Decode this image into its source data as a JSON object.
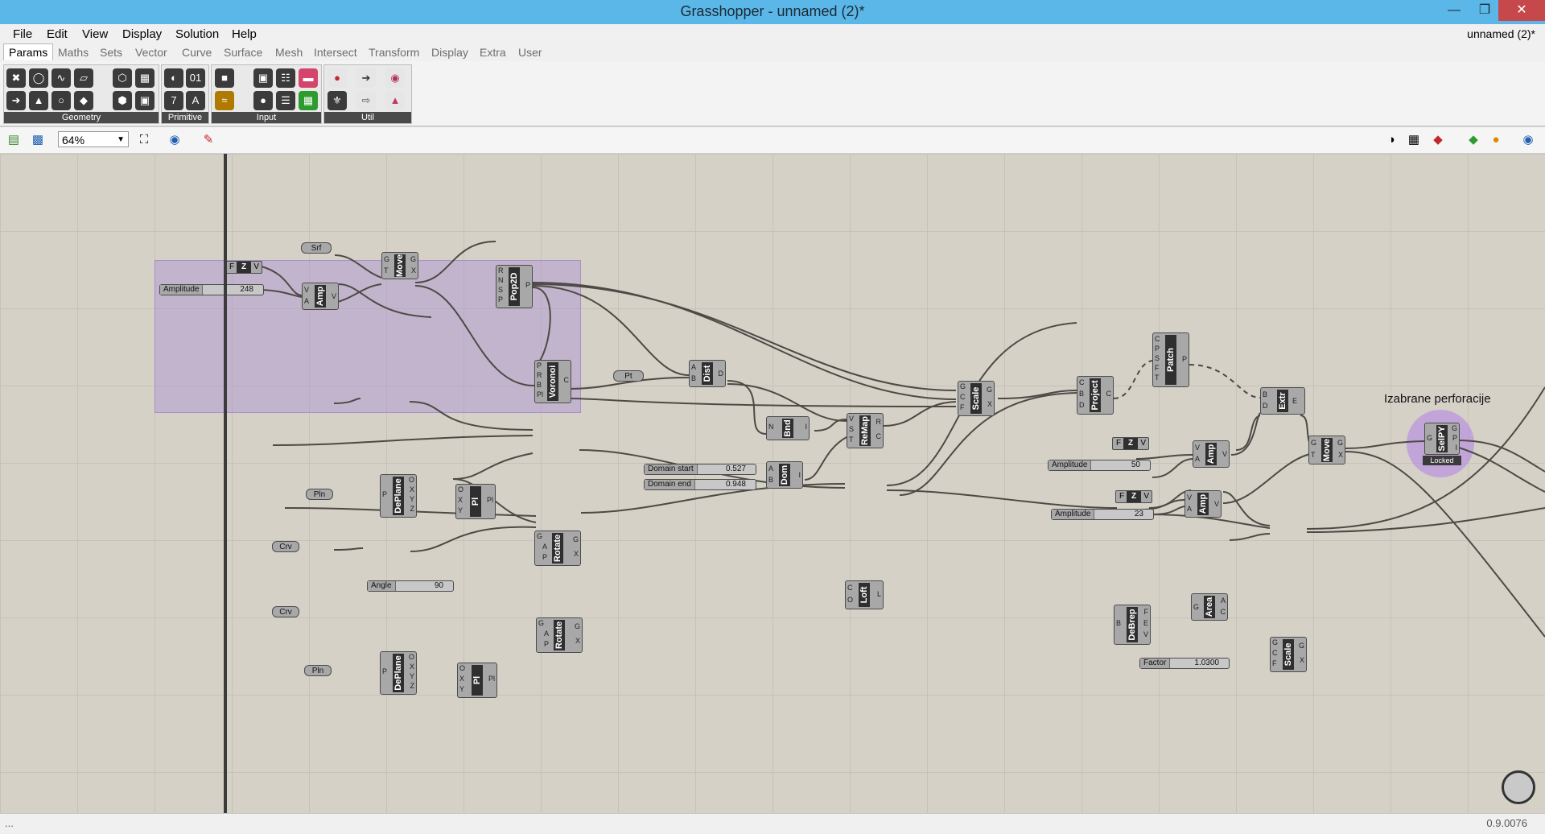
{
  "window": {
    "title": "Grasshopper - unnamed (2)*",
    "doc_name": "unnamed (2)*"
  },
  "menu": [
    "File",
    "Edit",
    "View",
    "Display",
    "Solution",
    "Help"
  ],
  "tabs": [
    "Params",
    "Maths",
    "Sets",
    "Vector",
    "Curve",
    "Surface",
    "Mesh",
    "Intersect",
    "Transform",
    "Display",
    "Extra",
    "User"
  ],
  "ribbon_groups": [
    "Geometry",
    "Primitive",
    "Input",
    "Util"
  ],
  "toolbar": {
    "zoom": "64%"
  },
  "canvas": {
    "annotation": "Izabrane perforacije",
    "components": [
      {
        "label": "Pop2D",
        "inputs": [
          "R",
          "N",
          "S",
          "P"
        ],
        "outputs": [
          "P"
        ]
      },
      {
        "label": "Move",
        "inputs": [
          "G",
          "T"
        ],
        "outputs": [
          "G",
          "X"
        ]
      },
      {
        "label": "Amp",
        "inputs": [
          "V",
          "A"
        ],
        "outputs": [
          "V"
        ]
      },
      {
        "label": "Voronoi",
        "inputs": [
          "P",
          "R",
          "B",
          "Pl"
        ],
        "outputs": [
          "C"
        ]
      },
      {
        "label": "Dist",
        "inputs": [
          "A",
          "B"
        ],
        "outputs": [
          "D"
        ]
      },
      {
        "label": "Bnd",
        "inputs": [
          "N"
        ],
        "outputs": [
          "I"
        ]
      },
      {
        "label": "ReMap",
        "inputs": [
          "V",
          "S",
          "T"
        ],
        "outputs": [
          "R",
          "C"
        ]
      },
      {
        "label": "Dom",
        "inputs": [
          "A",
          "B"
        ],
        "outputs": [
          "I"
        ]
      },
      {
        "label": "Scale",
        "inputs": [
          "G",
          "C",
          "F"
        ],
        "outputs": [
          "G",
          "X"
        ]
      },
      {
        "label": "Project",
        "inputs": [
          "C",
          "B",
          "D"
        ],
        "outputs": [
          "C"
        ]
      },
      {
        "label": "Patch",
        "inputs": [
          "C",
          "P",
          "S",
          "F",
          "T"
        ],
        "outputs": [
          "P"
        ]
      },
      {
        "label": "Extr",
        "inputs": [
          "B",
          "D"
        ],
        "outputs": [
          "E"
        ]
      },
      {
        "label": "Amp",
        "inputs": [
          "V",
          "A"
        ],
        "outputs": [
          "V"
        ]
      },
      {
        "label": "Amp",
        "inputs": [
          "V",
          "A"
        ],
        "outputs": [
          "V"
        ]
      },
      {
        "label": "Move",
        "inputs": [
          "G",
          "T"
        ],
        "outputs": [
          "G",
          "X"
        ]
      },
      {
        "label": "SelPY",
        "inputs": [
          "G"
        ],
        "outputs": [
          "G",
          "P",
          "I"
        ]
      },
      {
        "label": "DePlane",
        "inputs": [
          "P"
        ],
        "outputs": [
          "O",
          "X",
          "Y",
          "Z"
        ]
      },
      {
        "label": "Pl",
        "inputs": [
          "O",
          "X",
          "Y"
        ],
        "outputs": [
          "Pl"
        ]
      },
      {
        "label": "Rotate",
        "inputs": [
          "G",
          "A",
          "P"
        ],
        "outputs": [
          "G",
          "X"
        ]
      },
      {
        "label": "Rotate",
        "inputs": [
          "G",
          "A",
          "P"
        ],
        "outputs": [
          "G",
          "X"
        ]
      },
      {
        "label": "DePlane",
        "inputs": [
          "P"
        ],
        "outputs": [
          "O",
          "X",
          "Y",
          "Z"
        ]
      },
      {
        "label": "Pl",
        "inputs": [
          "O",
          "X",
          "Y"
        ],
        "outputs": [
          "Pl"
        ]
      },
      {
        "label": "Loft",
        "inputs": [
          "C",
          "O"
        ],
        "outputs": [
          "L"
        ]
      },
      {
        "label": "DeBrep",
        "inputs": [
          "B"
        ],
        "outputs": [
          "F",
          "E",
          "V"
        ]
      },
      {
        "label": "Area",
        "inputs": [
          "G"
        ],
        "outputs": [
          "A",
          "C"
        ]
      },
      {
        "label": "Scale",
        "inputs": [
          "G",
          "C",
          "F"
        ],
        "outputs": [
          "G",
          "X"
        ]
      }
    ],
    "params": [
      "Srf",
      "Pt",
      "Pln",
      "Crv",
      "Crv",
      "Pln"
    ],
    "sliders": [
      {
        "label": "Amplitude",
        "value": "248"
      },
      {
        "label": "Domain start",
        "value": "0.527"
      },
      {
        "label": "Domain end",
        "value": "0.948"
      },
      {
        "label": "Amplitude",
        "value": "50"
      },
      {
        "label": "Amplitude",
        "value": "23"
      },
      {
        "label": "Angle",
        "value": "90"
      },
      {
        "label": "Factor",
        "value": "1.0300"
      }
    ],
    "locked_label": "Locked",
    "z_vector": {
      "left": "F",
      "mid": "Z",
      "right": "V"
    }
  },
  "status": {
    "left": "...",
    "version": "0.9.0076"
  }
}
